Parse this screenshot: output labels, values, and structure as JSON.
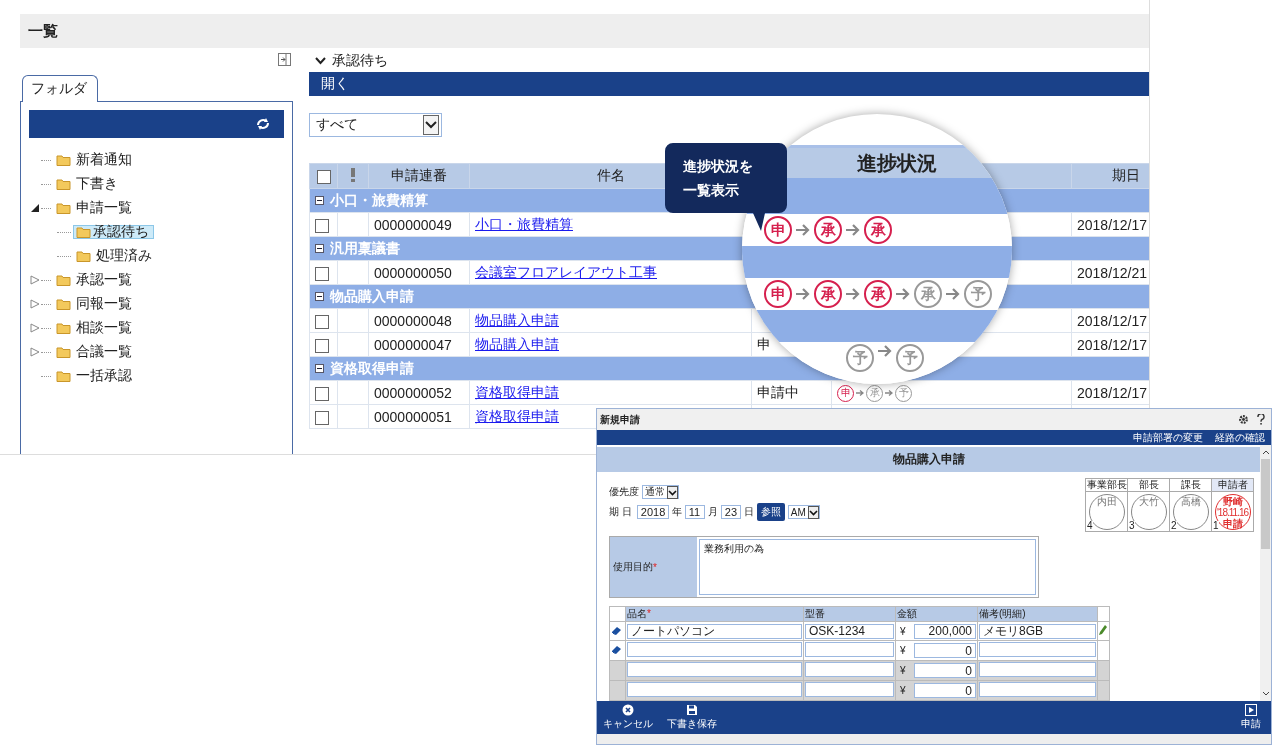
{
  "page": {
    "title": "一覧"
  },
  "sidebar": {
    "tab": {
      "label": "フォルダ",
      "selected": true
    },
    "tree": [
      {
        "label": "新着通知",
        "selected": false
      },
      {
        "label": "下書き",
        "selected": false
      },
      {
        "label": "申請一覧",
        "selected": false,
        "expanded": true,
        "children": [
          {
            "label": "承認待ち",
            "selected": true
          },
          {
            "label": "処理済み",
            "selected": false
          }
        ]
      },
      {
        "label": "承認一覧",
        "selected": false,
        "expanded": false
      },
      {
        "label": "同報一覧",
        "selected": false,
        "expanded": false
      },
      {
        "label": "相談一覧",
        "selected": false,
        "expanded": false
      },
      {
        "label": "合議一覧",
        "selected": false,
        "expanded": false
      },
      {
        "label": "一括承認",
        "selected": false
      }
    ]
  },
  "main": {
    "section": {
      "label": "承認待ち",
      "expanded": true
    },
    "open_button": "開く",
    "filter": {
      "value": "すべて"
    },
    "table": {
      "all_checked": false,
      "columns": {
        "number": "申請連番",
        "subject": "件名",
        "date": "期日"
      },
      "groups": [
        {
          "name": "小口・旅費精算",
          "expanded": true,
          "rows": [
            {
              "checked": false,
              "number": "0000000049",
              "subject": "小口・旅費精算",
              "date": "2018/12/17"
            }
          ]
        },
        {
          "name": "汎用稟議書",
          "expanded": true,
          "rows": [
            {
              "checked": false,
              "number": "0000000050",
              "subject": "会議室フロアレイアウト工事",
              "date": "2018/12/21"
            }
          ]
        },
        {
          "name": "物品購入申請",
          "expanded": true,
          "rows": [
            {
              "checked": false,
              "number": "0000000048",
              "subject": "物品購入申請",
              "date": "2018/12/17"
            },
            {
              "checked": false,
              "number": "0000000047",
              "subject": "物品購入申請",
              "status": "申",
              "date": "2018/12/17"
            }
          ]
        },
        {
          "name": "資格取得申請",
          "expanded": true,
          "rows": [
            {
              "checked": false,
              "number": "0000000052",
              "subject": "資格取得申請",
              "status": "申請中",
              "stamps": [
                {
                  "label": "申",
                  "done": true
                },
                {
                  "label": "承",
                  "done": false
                },
                {
                  "label": "予",
                  "done": false
                }
              ],
              "date": "2018/12/17"
            },
            {
              "checked": false,
              "number": "0000000051",
              "subject": "資格取得申請"
            }
          ]
        }
      ]
    }
  },
  "magnifier": {
    "header": "進捗状況",
    "rows": [
      {
        "kind": "band"
      },
      {
        "kind": "row",
        "stamps": [
          {
            "label": "申",
            "done": true
          },
          {
            "label": "承",
            "done": true
          },
          {
            "label": "承",
            "done": true
          }
        ]
      },
      {
        "kind": "band"
      },
      {
        "kind": "row",
        "stamps": [
          {
            "label": "申",
            "done": true
          },
          {
            "label": "承",
            "done": true
          },
          {
            "label": "承",
            "done": true
          },
          {
            "label": "承",
            "done": false
          },
          {
            "label": "予",
            "done": false
          }
        ]
      },
      {
        "kind": "band"
      },
      {
        "kind": "row",
        "stamps": [
          {
            "label": "予",
            "done": false
          },
          {
            "label": "予",
            "done": false
          }
        ]
      }
    ]
  },
  "callout": {
    "lines": [
      "進捗状況を",
      "一覧表示"
    ]
  },
  "dialog": {
    "title": "新規申請",
    "links": [
      "申請部署の変更",
      "経路の確認"
    ],
    "form_title": "物品購入申請",
    "priority": {
      "label": "優先度",
      "value": "通常"
    },
    "due": {
      "label": "期 日",
      "year": "2018",
      "year_unit": "年",
      "month": "11",
      "month_unit": "月",
      "day": "23",
      "day_unit": "日",
      "button": "参照",
      "ampm": "AM"
    },
    "approvals": [
      {
        "role": "事業部長",
        "name": "内田",
        "order": "4",
        "approved": false
      },
      {
        "role": "部長",
        "name": "大竹",
        "order": "3",
        "approved": false
      },
      {
        "role": "課長",
        "name": "高橋",
        "order": "2",
        "approved": false
      },
      {
        "role": "申請者",
        "name": "野崎",
        "date": "'18.11.16",
        "note": "申請",
        "order": "1",
        "approved": true
      }
    ],
    "purpose": {
      "label": "使用目的",
      "required_mark": "*",
      "value": "業務利用の為"
    },
    "items": {
      "columns": [
        {
          "label": "品名",
          "required_mark": "*"
        },
        {
          "label": "型番"
        },
        {
          "label": "金額"
        },
        {
          "label": "備考(明細)"
        }
      ],
      "rows": [
        {
          "enabled": true,
          "edited": true,
          "name": "ノートパソコン",
          "model": "OSK-1234",
          "currency": "¥",
          "amount": "200,000",
          "note": "メモリ8GB"
        },
        {
          "enabled": true,
          "edited": false,
          "currency": "¥",
          "amount": "0"
        },
        {
          "enabled": false,
          "edited": false,
          "currency": "¥",
          "amount": "0"
        },
        {
          "enabled": false,
          "edited": false,
          "currency": "¥",
          "amount": "0"
        }
      ]
    },
    "footer": {
      "left": [
        "キャンセル",
        "下書き保存"
      ],
      "right": [
        "申請"
      ]
    }
  }
}
